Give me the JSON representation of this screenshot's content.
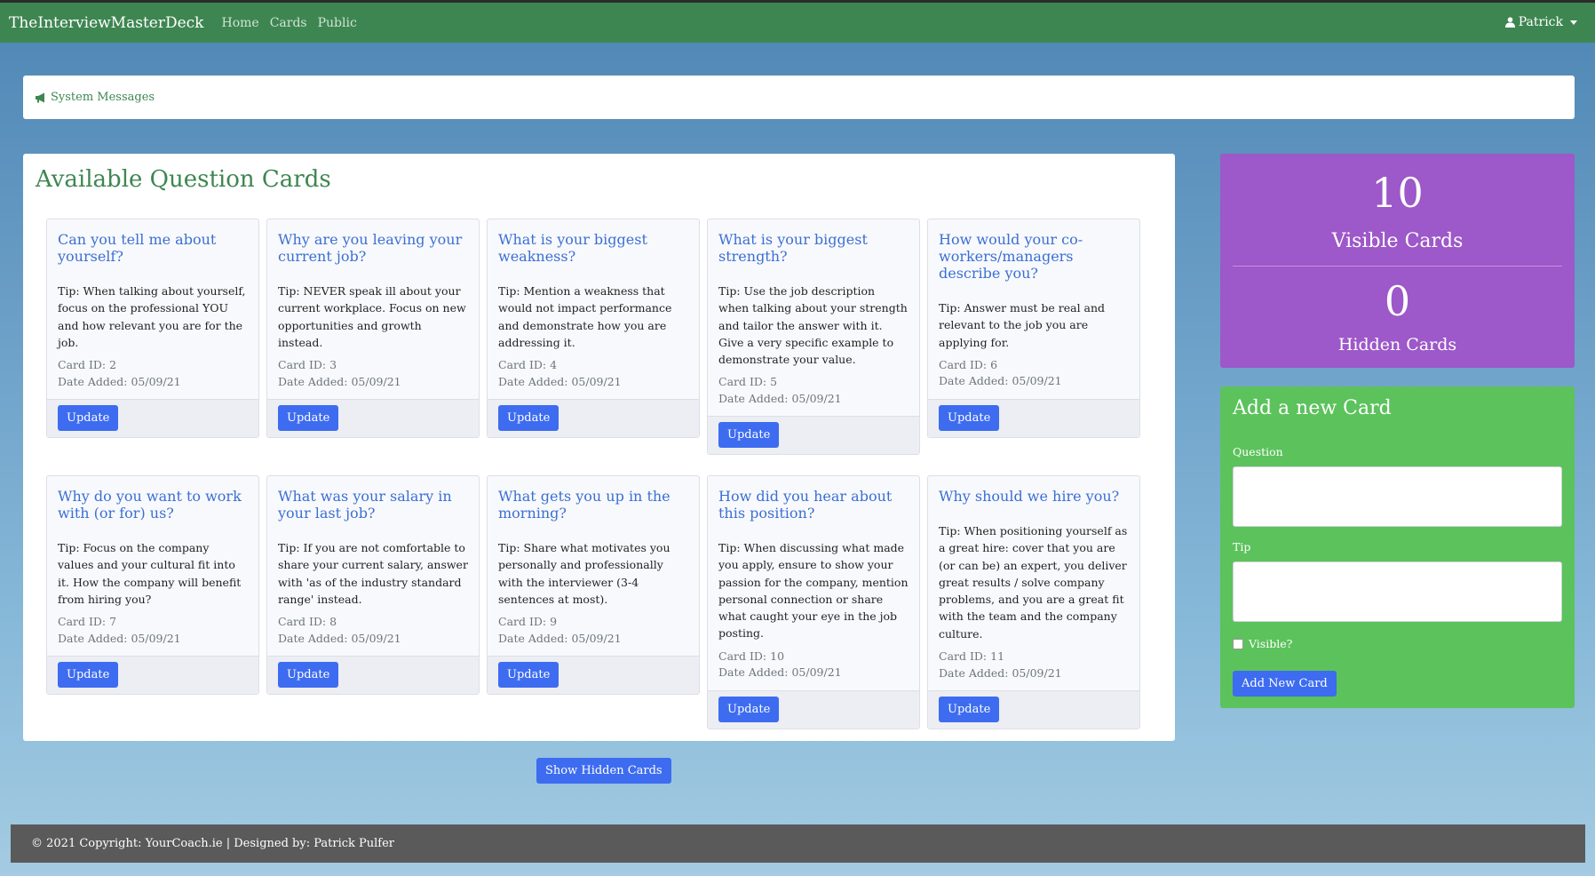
{
  "nav": {
    "brand": "TheInterviewMasterDeck",
    "links": [
      "Home",
      "Cards",
      "Public"
    ],
    "user": "Patrick"
  },
  "system_messages": "System Messages",
  "main": {
    "title": "Available Question Cards",
    "update_label": "Update",
    "cards": [
      {
        "question": "Can you tell me about yourself?",
        "tip": "Tip: When talking about yourself, focus on the professional YOU and how relevant you are for the job.",
        "card_id": "Card ID: 2",
        "date_added": "Date Added: 05/09/21"
      },
      {
        "question": "Why are you leaving your current job?",
        "tip": "Tip: NEVER speak ill about your current workplace. Focus on new opportunities and growth instead.",
        "card_id": "Card ID: 3",
        "date_added": "Date Added: 05/09/21"
      },
      {
        "question": "What is your biggest weakness?",
        "tip": "Tip: Mention a weakness that would not impact performance and demonstrate how you are addressing it.",
        "card_id": "Card ID: 4",
        "date_added": "Date Added: 05/09/21"
      },
      {
        "question": "What is your biggest strength?",
        "tip": "Tip: Use the job description when talking about your strength and tailor the answer with it. Give a very specific example to demonstrate your value.",
        "card_id": "Card ID: 5",
        "date_added": "Date Added: 05/09/21"
      },
      {
        "question": "How would your co-workers/managers describe you?",
        "tip": "Tip: Answer must be real and relevant to the job you are applying for.",
        "card_id": "Card ID: 6",
        "date_added": "Date Added: 05/09/21"
      },
      {
        "question": "Why do you want to work with (or for) us?",
        "tip": "Tip: Focus on the company values and your cultural fit into it. How the company will benefit from hiring you?",
        "card_id": "Card ID: 7",
        "date_added": "Date Added: 05/09/21"
      },
      {
        "question": "What was your salary in your last job?",
        "tip": "Tip: If you are not comfortable to share your current salary, answer with 'as of the industry standard range' instead.",
        "card_id": "Card ID: 8",
        "date_added": "Date Added: 05/09/21"
      },
      {
        "question": "What gets you up in the morning?",
        "tip": "Tip: Share what motivates you personally and professionally with the interviewer (3-4 sentences at most).",
        "card_id": "Card ID: 9",
        "date_added": "Date Added: 05/09/21"
      },
      {
        "question": "How did you hear about this position?",
        "tip": "Tip: When discussing what made you apply, ensure to show your passion for the company, mention personal connection or share what caught your eye in the job posting.",
        "card_id": "Card ID: 10",
        "date_added": "Date Added: 05/09/21"
      },
      {
        "question": "Why should we hire you?",
        "tip": "Tip: When positioning yourself as a great hire: cover that you are (or can be) an expert, you deliver great results / solve company problems, and you are a great fit with the team and the company culture.",
        "card_id": "Card ID: 11",
        "date_added": "Date Added: 05/09/21"
      }
    ],
    "show_hidden_label": "Show Hidden Cards"
  },
  "stats": {
    "visible_count": "10",
    "visible_label": "Visible Cards",
    "hidden_count": "0",
    "hidden_label": "Hidden Cards"
  },
  "add_card": {
    "title": "Add a new Card",
    "question_label": "Question",
    "tip_label": "Tip",
    "visible_label": "Visible?",
    "visible_checked": false,
    "submit_label": "Add New Card"
  },
  "footer": "© 2021 Copyright: YourCoach.ie | Designed by: Patrick Pulfer",
  "colors": {
    "navbar": "#3e8651",
    "accent_button": "#3d6cf0",
    "stats_panel": "#9d58c9",
    "add_panel": "#5cc25c",
    "footer": "#5a5a5a",
    "question_text": "#3b6fd4"
  },
  "icons": {
    "user": "user-icon",
    "messages": "bullhorn-icon"
  }
}
